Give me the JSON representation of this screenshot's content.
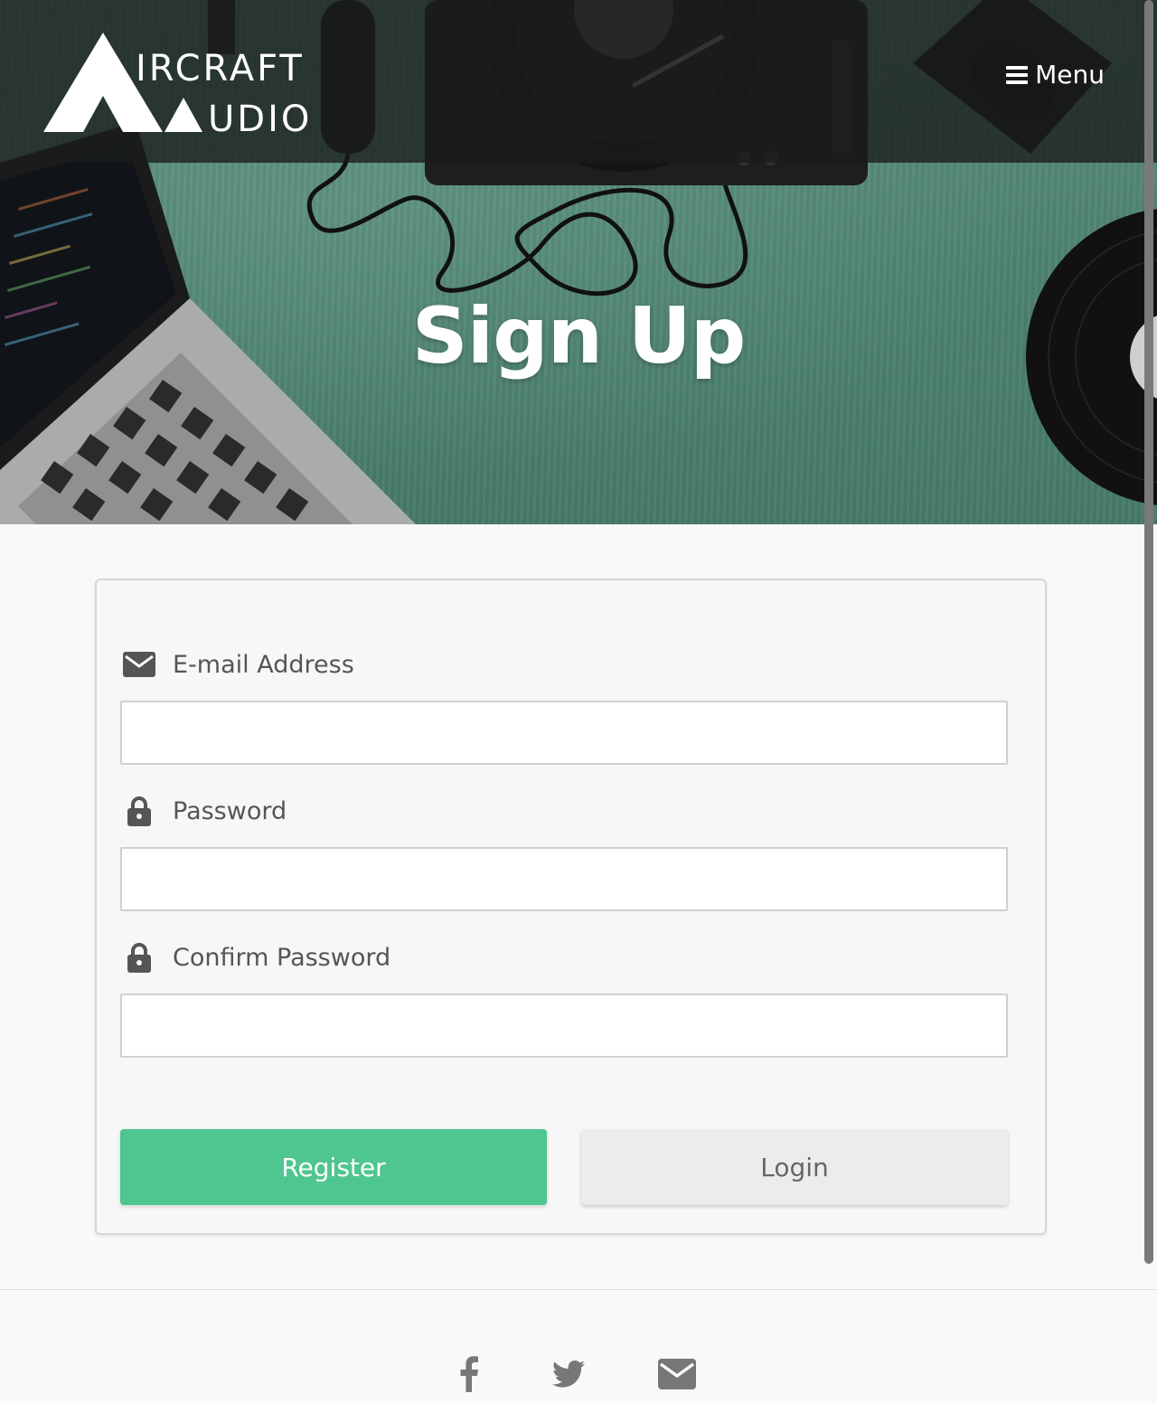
{
  "brand": {
    "line1": "IRCRAFT",
    "line2": "UDIO"
  },
  "nav": {
    "menu_label": "Menu",
    "menu_icon": "hamburger-icon"
  },
  "hero": {
    "title": "Sign Up"
  },
  "form": {
    "email": {
      "label": "E-mail Address",
      "icon": "envelope-icon",
      "value": "",
      "placeholder": ""
    },
    "password": {
      "label": "Password",
      "icon": "lock-icon",
      "value": "",
      "placeholder": ""
    },
    "confirm_password": {
      "label": "Confirm Password",
      "icon": "lock-icon",
      "value": "",
      "placeholder": ""
    },
    "register_label": "Register",
    "login_label": "Login"
  },
  "footer": {
    "social": [
      {
        "icon": "facebook-icon"
      },
      {
        "icon": "twitter-icon"
      },
      {
        "icon": "email-icon"
      }
    ]
  },
  "colors": {
    "accent_green": "#4fc690",
    "navbar_dark": "#1c1f1e",
    "hero_teal": "#4f8373"
  }
}
